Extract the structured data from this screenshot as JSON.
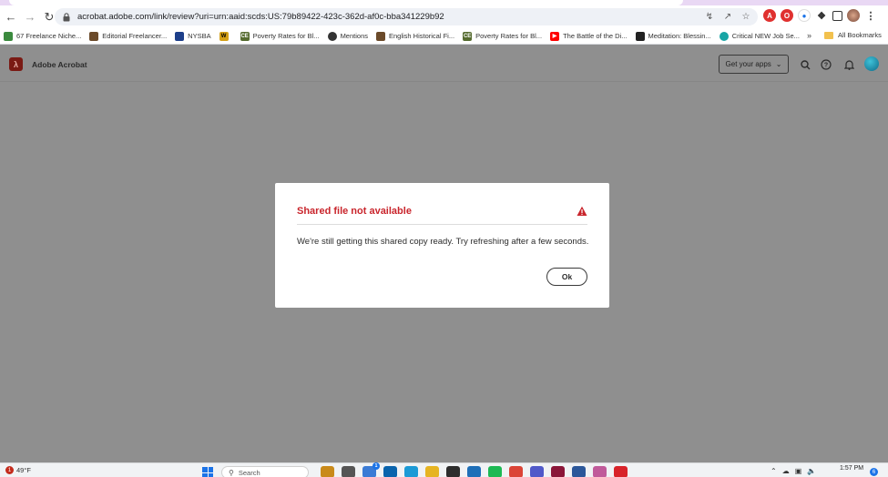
{
  "browser": {
    "url": "acrobat.adobe.com/link/review?uri=urn:aaid:scds:US:79b89422-423c-362d-af0c-bba341229b92",
    "bookmarks": [
      {
        "label": "67 Freelance Niche...",
        "icon": "leaf-icon",
        "color": "#3b8a3e"
      },
      {
        "label": "Editorial Freelancer...",
        "icon": "editorial-icon",
        "color": "#6b4a2a"
      },
      {
        "label": "NYSBA",
        "icon": "nysba-icon",
        "color": "#1d3f8a"
      },
      {
        "label": "",
        "icon": "w-icon",
        "color": "#d4a017"
      },
      {
        "label": "Poverty Rates for Bl...",
        "icon": "ce-icon",
        "color": "#556b2f"
      },
      {
        "label": "Mentions",
        "icon": "mentions-icon",
        "color": "#333333"
      },
      {
        "label": "English Historical Fi...",
        "icon": "book-icon",
        "color": "#6b4a2a"
      },
      {
        "label": "Poverty Rates for Bl...",
        "icon": "ce-icon",
        "color": "#556b2f"
      },
      {
        "label": "The Battle of the Di...",
        "icon": "youtube-icon",
        "color": "#ff0000"
      },
      {
        "label": "Meditation: Blessin...",
        "icon": "meditation-icon",
        "color": "#222222"
      },
      {
        "label": "Critical NEW Job Se...",
        "icon": "job-icon",
        "color": "#18a5a5"
      }
    ],
    "more_label": "»",
    "all_bookmarks": "All Bookmarks"
  },
  "app": {
    "name": "Adobe Acrobat",
    "get_apps": "Get your apps",
    "brand_color": "#7a1a14"
  },
  "modal": {
    "title": "Shared file not available",
    "message": "We're still getting this shared copy ready. Try refreshing after a few seconds.",
    "ok_label": "Ok",
    "title_color": "#c9252c"
  },
  "taskbar": {
    "weather_badge": "1",
    "temperature": "49°F",
    "search_placeholder": "Search",
    "time": "1:57 PM",
    "notification_count": "6",
    "apps": [
      {
        "name": "briefcase-app-icon",
        "color": "#c98a1a",
        "badge": ""
      },
      {
        "name": "taskview-app-icon",
        "color": "#555555",
        "badge": ""
      },
      {
        "name": "copilot-app-icon",
        "color": "#3a7bd5",
        "badge": "1"
      },
      {
        "name": "outlook-app-icon",
        "color": "#0a64ad",
        "badge": ""
      },
      {
        "name": "edge-app-icon",
        "color": "#1b9ad6",
        "badge": ""
      },
      {
        "name": "file-explorer-app-icon",
        "color": "#e6b422",
        "badge": ""
      },
      {
        "name": "terminal-app-icon",
        "color": "#2d2d2d",
        "badge": ""
      },
      {
        "name": "p-app-icon",
        "color": "#1e6fb8",
        "badge": ""
      },
      {
        "name": "spotify-app-icon",
        "color": "#1db954",
        "badge": ""
      },
      {
        "name": "chrome-app-icon",
        "color": "#db4437",
        "badge": ""
      },
      {
        "name": "teams-app-icon",
        "color": "#5059c9",
        "badge": ""
      },
      {
        "name": "indesign-app-icon",
        "color": "#8a1538",
        "badge": ""
      },
      {
        "name": "word-app-icon",
        "color": "#2b579a",
        "badge": ""
      },
      {
        "name": "snip-app-icon",
        "color": "#c05a9a",
        "badge": ""
      },
      {
        "name": "acrobat-app-icon",
        "color": "#d8232a",
        "badge": ""
      }
    ]
  }
}
